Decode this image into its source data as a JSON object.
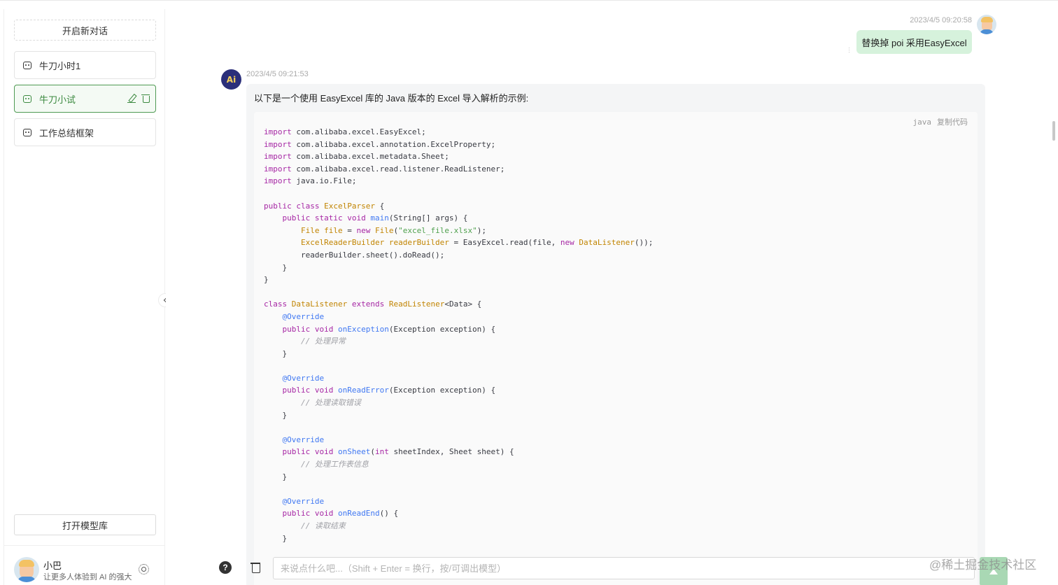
{
  "sidebar": {
    "new_chat_label": "开启新对话",
    "conversations": [
      {
        "label": "牛刀小时1"
      },
      {
        "label": "牛刀小试"
      },
      {
        "label": "工作总结框架"
      }
    ],
    "model_library_label": "打开模型库",
    "user": {
      "name": "小巴",
      "description": "让更多人体验到 AI 的强大"
    }
  },
  "chat": {
    "user_message": {
      "time": "2023/4/5 09:20:58",
      "text": "替换掉 poi 采用EasyExcel"
    },
    "ai_message": {
      "avatar_text": "Ai",
      "time": "2023/4/5 09:21:53",
      "intro": "以下是一个使用 EasyExcel 库的 Java 版本的 Excel 导入解析的示例:",
      "code_language": "java",
      "copy_label": "复制代码"
    }
  },
  "input": {
    "placeholder": "来说点什么吧...（Shift + Enter = 换行，按/可调出模型）",
    "value": ""
  },
  "watermark": "@稀土掘金技术社区",
  "colors": {
    "accent": "#3c8a40",
    "active_bg": "#f4faf4",
    "user_bubble": "#d6f2dc",
    "ai_bubble": "#f4f5f6",
    "send_button": "#a9d8b4"
  }
}
